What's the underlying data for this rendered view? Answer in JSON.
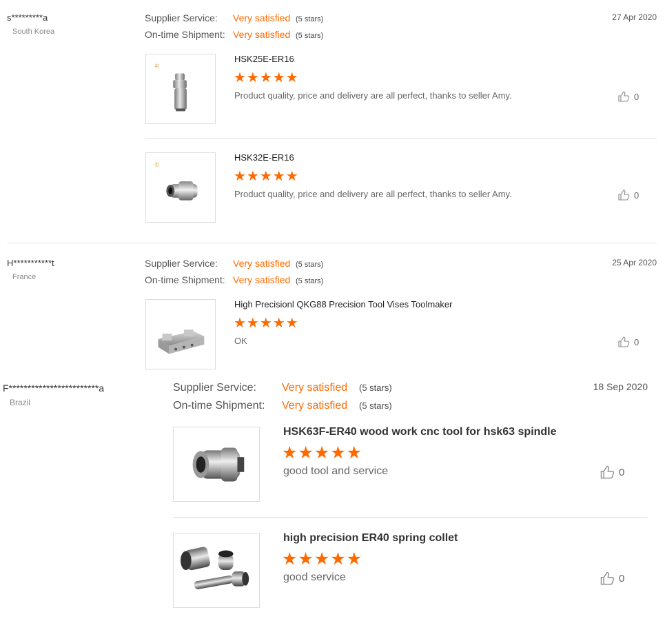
{
  "reviews": [
    {
      "buyer": "s*********a",
      "country": "South Korea",
      "date": "27 Apr 2020",
      "supplier_label": "Supplier Service:",
      "supplier_value": "Very satisfied",
      "supplier_stars": "(5 stars)",
      "shipment_label": "On-time Shipment:",
      "shipment_value": "Very satisfied",
      "shipment_stars": "(5 stars)",
      "products": [
        {
          "title": "HSK25E-ER16",
          "rating": 5,
          "stars": "★★★★★",
          "comment": "Product quality, price and delivery are all perfect, thanks to seller Amy.",
          "likes": "0",
          "thumb_icon": "hsk25e-collet-holder-image"
        },
        {
          "title": "HSK32E-ER16",
          "rating": 5,
          "stars": "★★★★★",
          "comment": "Product quality, price and delivery are all perfect, thanks to seller Amy.",
          "likes": "0",
          "thumb_icon": "hsk32e-collet-holder-image"
        }
      ]
    },
    {
      "buyer": "H***********t",
      "country": "France",
      "date": "25 Apr 2020",
      "supplier_label": "Supplier Service:",
      "supplier_value": "Very satisfied",
      "supplier_stars": "(5 stars)",
      "shipment_label": "On-time Shipment:",
      "shipment_value": "Very satisfied",
      "shipment_stars": "(5 stars)",
      "products": [
        {
          "title": "High Precisionl QKG88 Precision Tool Vises Toolmaker",
          "rating": 5,
          "stars": "★★★★★",
          "comment": "OK",
          "likes": "0",
          "thumb_icon": "precision-vise-image"
        }
      ]
    },
    {
      "buyer": "F************************a",
      "country": "Brazil",
      "date": "18 Sep 2020",
      "supplier_label": "Supplier Service:",
      "supplier_value": "Very satisfied",
      "supplier_stars": "(5 stars)",
      "shipment_label": "On-time Shipment:",
      "shipment_value": "Very satisfied",
      "shipment_stars": "(5 stars)",
      "products": [
        {
          "title": "HSK63F-ER40 wood work cnc tool for hsk63 spindle",
          "rating": 5,
          "stars": "★★★★★",
          "comment": "good tool and service",
          "likes": "0",
          "thumb_icon": "hsk63f-tool-holder-image"
        },
        {
          "title": "high precision ER40 spring collet",
          "rating": 5,
          "stars": "★★★★★",
          "comment": "good service",
          "likes": "0",
          "thumb_icon": "er40-collet-set-image"
        }
      ]
    }
  ],
  "colors": {
    "accent": "#ff6a00",
    "divider": "#e2e2e2",
    "text": "#333333",
    "muted": "#888888"
  }
}
